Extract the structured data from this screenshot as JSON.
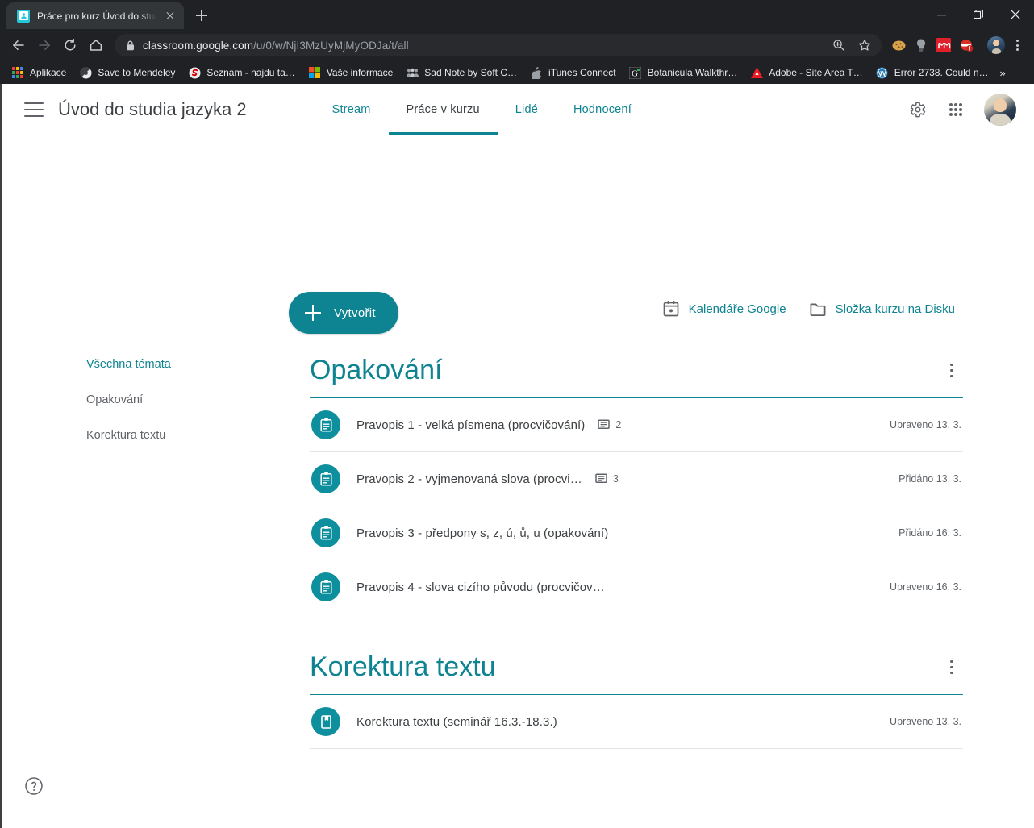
{
  "browser": {
    "tab": {
      "title": "Práce pro kurz Úvod do studia ja",
      "favicon": "classroom-favicon",
      "close": "close-icon"
    },
    "newtab_label": "+",
    "window_controls": {
      "minimize": "minimize-icon",
      "restore": "restore-icon",
      "close": "close-icon"
    },
    "nav": {
      "back": "back-arrow-icon",
      "forward": "forward-arrow-icon",
      "reload": "reload-icon",
      "home": "home-icon"
    },
    "omnibox": {
      "lock": "lock-icon",
      "url_domain": "classroom.google.com",
      "url_path": "/u/0/w/NjI3MzUyMjMyODJa/t/all",
      "url_full": "classroom.google.com/u/0/w/NjI3MzUyMjMyODJa/t/all",
      "zoom_icon": "zoom-in-icon",
      "bookmark_icon": "star-icon"
    },
    "extensions": [
      {
        "name": "cookie-extension-icon",
        "color": "#d8a14a"
      },
      {
        "name": "lamp-extension-icon",
        "color": "#9aa0a6"
      },
      {
        "name": "mendeley-extension-icon",
        "color": "#e0202a"
      },
      {
        "name": "ninja-extension-icon",
        "color": "#d93025"
      }
    ],
    "profile": "profile-avatar",
    "menu": "three-dot-menu-icon",
    "bookmarks": [
      {
        "label": "Aplikace",
        "icon": "apps-grid-icon"
      },
      {
        "label": "Save to Mendeley",
        "icon": "mendeley-icon"
      },
      {
        "label": "Seznam - najdu ta…",
        "icon": "seznam-icon"
      },
      {
        "label": "Vaše informace",
        "icon": "microsoft-icon"
      },
      {
        "label": "Sad Note by Soft C…",
        "icon": "sadnote-icon"
      },
      {
        "label": "iTunes Connect",
        "icon": "apple-icon"
      },
      {
        "label": "Botanicula Walkthr…",
        "icon": "g-icon"
      },
      {
        "label": "Adobe - Site Area T…",
        "icon": "adobe-icon"
      },
      {
        "label": "Error 2738. Could n…",
        "icon": "wordpress-icon"
      }
    ],
    "bookmarks_overflow": "»"
  },
  "classroom": {
    "menu_icon": "hamburger-menu-icon",
    "course_title": "Úvod do studia jazyka 2",
    "tabs": [
      {
        "label": "Stream",
        "active": false
      },
      {
        "label": "Práce v kurzu",
        "active": true
      },
      {
        "label": "Lidé",
        "active": false
      },
      {
        "label": "Hodnocení",
        "active": false
      }
    ],
    "header_actions": {
      "settings": "gear-icon",
      "apps": "google-apps-grid-icon",
      "avatar": "user-avatar"
    },
    "create_button": {
      "label": "Vytvořit",
      "icon": "plus-icon"
    },
    "quick_links": [
      {
        "label": "Kalendáře Google",
        "icon": "calendar-icon"
      },
      {
        "label": "Složka kurzu na Disku",
        "icon": "folder-icon"
      }
    ],
    "topics_nav": [
      {
        "label": "Všechna témata",
        "active": true
      },
      {
        "label": "Opakování",
        "active": false
      },
      {
        "label": "Korektura textu",
        "active": false
      }
    ],
    "topics": [
      {
        "name": "Opakování",
        "menu": "kebab-menu-icon",
        "items": [
          {
            "icon": "assignment-icon",
            "title": "Pravopis 1 - velká písmena (procvičování)",
            "comments": "2",
            "date": "Upraveno 13. 3."
          },
          {
            "icon": "assignment-icon",
            "title": "Pravopis 2 - vyjmenovaná slova (procvi…",
            "comments": "3",
            "date": "Přidáno 13. 3."
          },
          {
            "icon": "assignment-icon",
            "title": "Pravopis 3 - předpony s, z, ú, ů, u (opakování)",
            "comments": "",
            "date": "Přidáno 16. 3."
          },
          {
            "icon": "assignment-icon",
            "title": "Pravopis 4 - slova cizího původu (procvičov…",
            "comments": "",
            "date": "Upraveno 16. 3."
          }
        ]
      },
      {
        "name": "Korektura textu",
        "menu": "kebab-menu-icon",
        "items": [
          {
            "icon": "material-book-icon",
            "title": "Korektura textu (seminář 16.3.-18.3.)",
            "comments": "",
            "date": "Upraveno 13. 3."
          }
        ]
      }
    ],
    "help_button": "help-icon",
    "accent_color": "#0e8391",
    "icon_circle_color": "#0e8f9d"
  }
}
